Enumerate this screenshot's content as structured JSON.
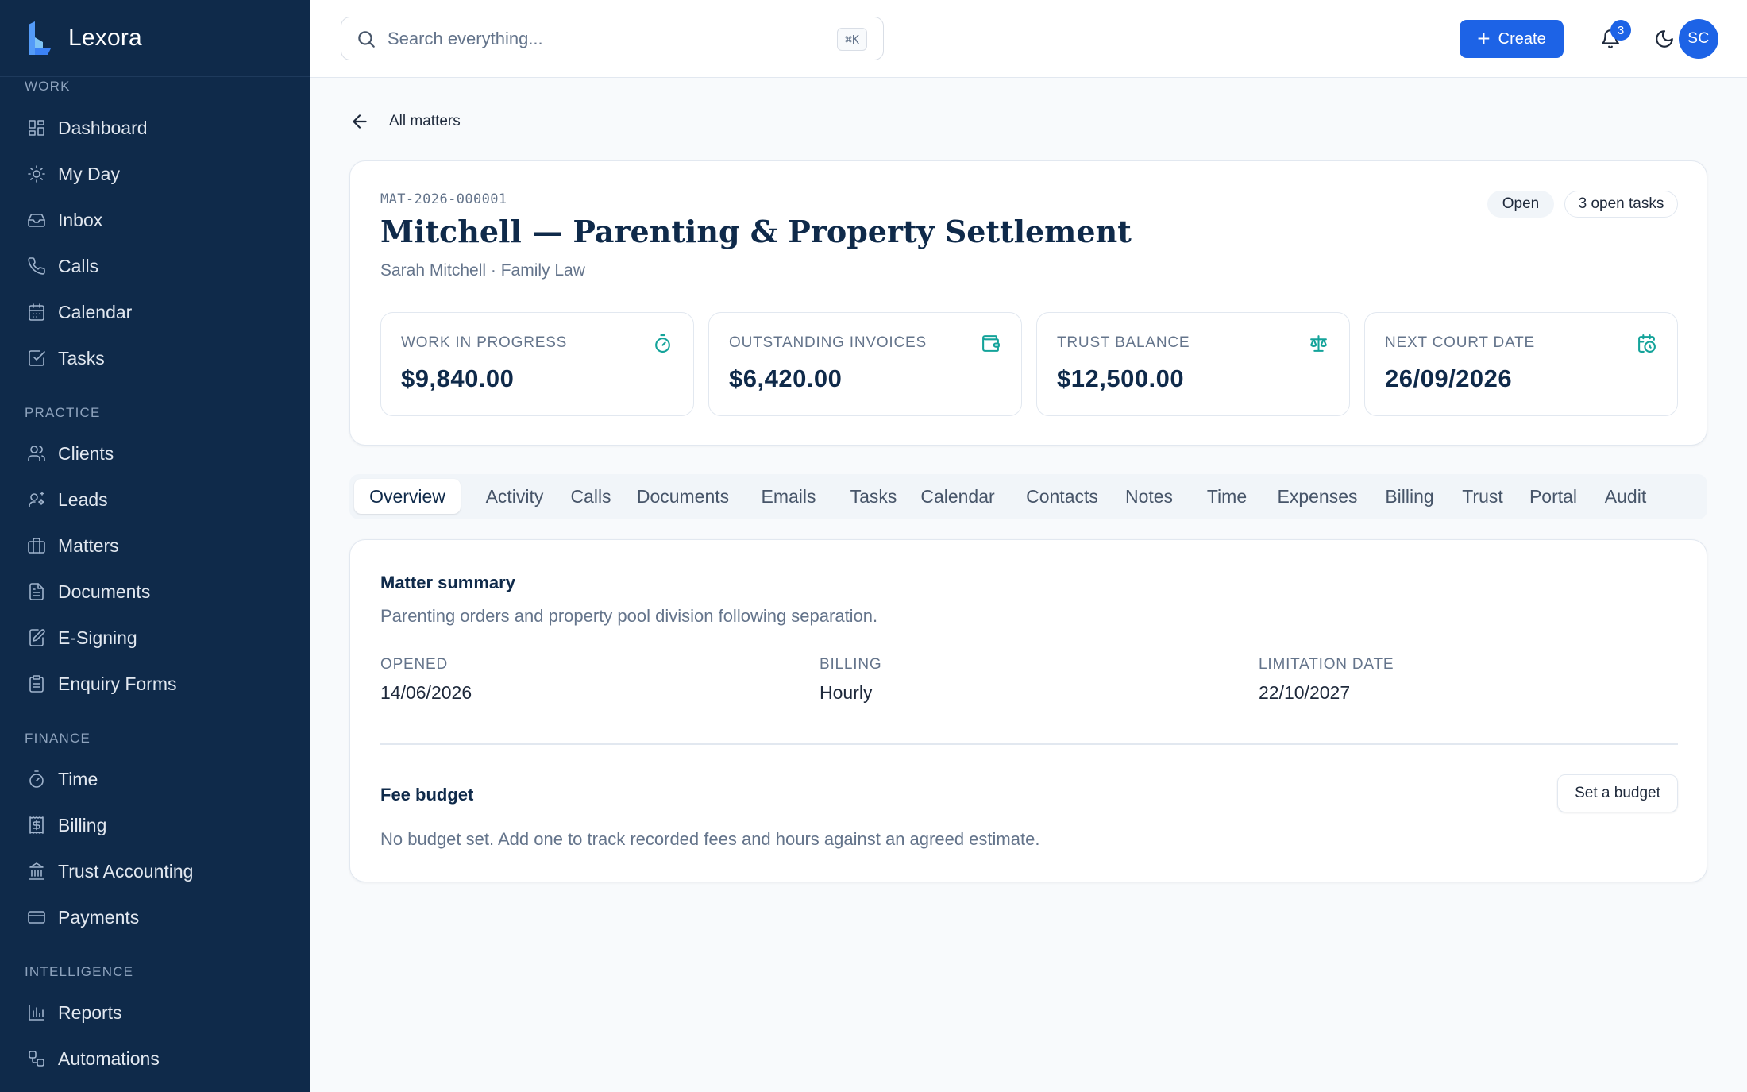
{
  "brand": {
    "name": "Lexora"
  },
  "sidebar": {
    "sections": [
      {
        "title": "WORK",
        "items": [
          "Dashboard",
          "My Day",
          "Inbox",
          "Calls",
          "Calendar",
          "Tasks"
        ]
      },
      {
        "title": "PRACTICE",
        "items": [
          "Clients",
          "Leads",
          "Matters",
          "Documents",
          "E-Signing",
          "Enquiry Forms"
        ]
      },
      {
        "title": "FINANCE",
        "items": [
          "Time",
          "Billing",
          "Trust Accounting",
          "Payments"
        ]
      },
      {
        "title": "INTELLIGENCE",
        "items": [
          "Reports",
          "Automations"
        ]
      }
    ]
  },
  "topbar": {
    "search_placeholder": "Search everything...",
    "search_shortcut": "⌘K",
    "create_label": "Create",
    "notification_count": "3",
    "avatar_initials": "SC"
  },
  "back": {
    "label": "All matters"
  },
  "matter": {
    "id": "MAT-2026-000001",
    "title": "Mitchell — Parenting & Property Settlement",
    "subtitle": "Sarah Mitchell · Family Law",
    "status": "Open",
    "open_tasks": "3 open tasks"
  },
  "stats": [
    {
      "label": "WORK IN PROGRESS",
      "value": "$9,840.00",
      "icon": "timer-icon"
    },
    {
      "label": "OUTSTANDING INVOICES",
      "value": "$6,420.00",
      "icon": "wallet-icon"
    },
    {
      "label": "TRUST BALANCE",
      "value": "$12,500.00",
      "icon": "scale-icon"
    },
    {
      "label": "NEXT COURT DATE",
      "value": "26/09/2026",
      "icon": "calendar-clock-icon"
    }
  ],
  "tabs": [
    "Overview",
    "Activity",
    "Calls",
    "Documents",
    "Emails",
    "Tasks",
    "Calendar",
    "Contacts",
    "Notes",
    "Time",
    "Expenses",
    "Billing",
    "Trust",
    "Portal",
    "Audit"
  ],
  "summary": {
    "title": "Matter summary",
    "description": "Parenting orders and property pool division following separation.",
    "fields": [
      {
        "label": "OPENED",
        "value": "14/06/2026"
      },
      {
        "label": "BILLING",
        "value": "Hourly"
      },
      {
        "label": "LIMITATION DATE",
        "value": "22/10/2027"
      }
    ]
  },
  "budget": {
    "title": "Fee budget",
    "button_label": "Set a budget",
    "empty_text": "No budget set. Add one to track recorded fees and hours against an agreed estimate."
  },
  "colors": {
    "sidebar_bg": "#0f2a4a",
    "accent": "#1d63e6",
    "teal": "#14a39a"
  }
}
